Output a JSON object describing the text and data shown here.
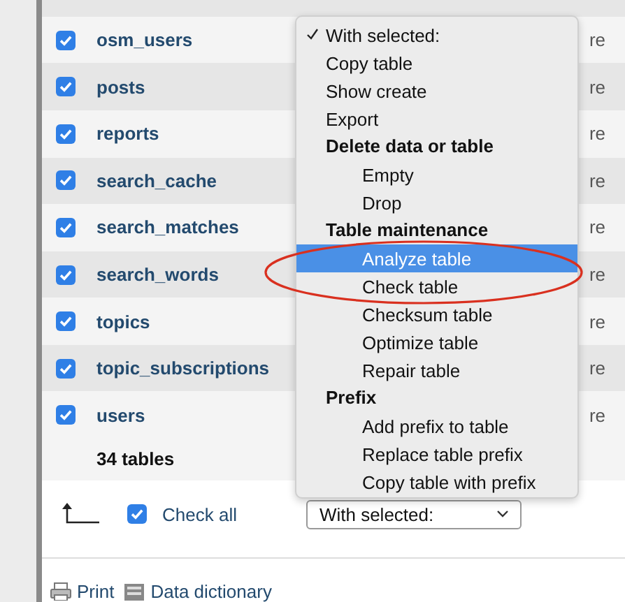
{
  "rows": [
    {
      "name": "osm_users",
      "checked": true,
      "column_2": "re"
    },
    {
      "name": "posts",
      "checked": true,
      "column_2": "re"
    },
    {
      "name": "reports",
      "checked": true,
      "column_2": "re"
    },
    {
      "name": "search_cache",
      "checked": true,
      "column_2": "re"
    },
    {
      "name": "search_matches",
      "checked": true,
      "column_2": "re"
    },
    {
      "name": "search_words",
      "checked": true,
      "column_2": "re"
    },
    {
      "name": "topics",
      "checked": true,
      "column_2": "re"
    },
    {
      "name": "topic_subscriptions",
      "checked": true,
      "column_2": "re"
    },
    {
      "name": "users",
      "checked": true,
      "column_2": "re"
    }
  ],
  "summary": "34 tables",
  "check_all": {
    "label": "Check all",
    "checked": true
  },
  "select": {
    "value": "With selected:"
  },
  "menu": [
    {
      "kind": "option",
      "label": "With selected:",
      "selected": false,
      "checked": true
    },
    {
      "kind": "option",
      "label": "Copy table",
      "selected": false,
      "checked": false
    },
    {
      "kind": "option",
      "label": "Show create",
      "selected": false,
      "checked": false
    },
    {
      "kind": "option",
      "label": "Export",
      "selected": false,
      "checked": false
    },
    {
      "kind": "group",
      "label": "Delete data or table"
    },
    {
      "kind": "sub",
      "label": "Empty",
      "selected": false,
      "checked": false
    },
    {
      "kind": "sub",
      "label": "Drop",
      "selected": false,
      "checked": false
    },
    {
      "kind": "group",
      "label": "Table maintenance"
    },
    {
      "kind": "sub",
      "label": "Analyze table",
      "selected": true,
      "checked": false
    },
    {
      "kind": "sub",
      "label": "Check table",
      "selected": false,
      "checked": false
    },
    {
      "kind": "sub",
      "label": "Checksum table",
      "selected": false,
      "checked": false
    },
    {
      "kind": "sub",
      "label": "Optimize table",
      "selected": false,
      "checked": false
    },
    {
      "kind": "sub",
      "label": "Repair table",
      "selected": false,
      "checked": false
    },
    {
      "kind": "group",
      "label": "Prefix"
    },
    {
      "kind": "sub",
      "label": "Add prefix to table",
      "selected": false,
      "checked": false
    },
    {
      "kind": "sub",
      "label": "Replace table prefix",
      "selected": false,
      "checked": false
    },
    {
      "kind": "sub",
      "label": "Copy table with prefix",
      "selected": false,
      "checked": false
    }
  ],
  "footer_links": [
    {
      "kind": "print",
      "label": "Print"
    },
    {
      "kind": "dictionary",
      "label": "Data dictionary"
    }
  ]
}
